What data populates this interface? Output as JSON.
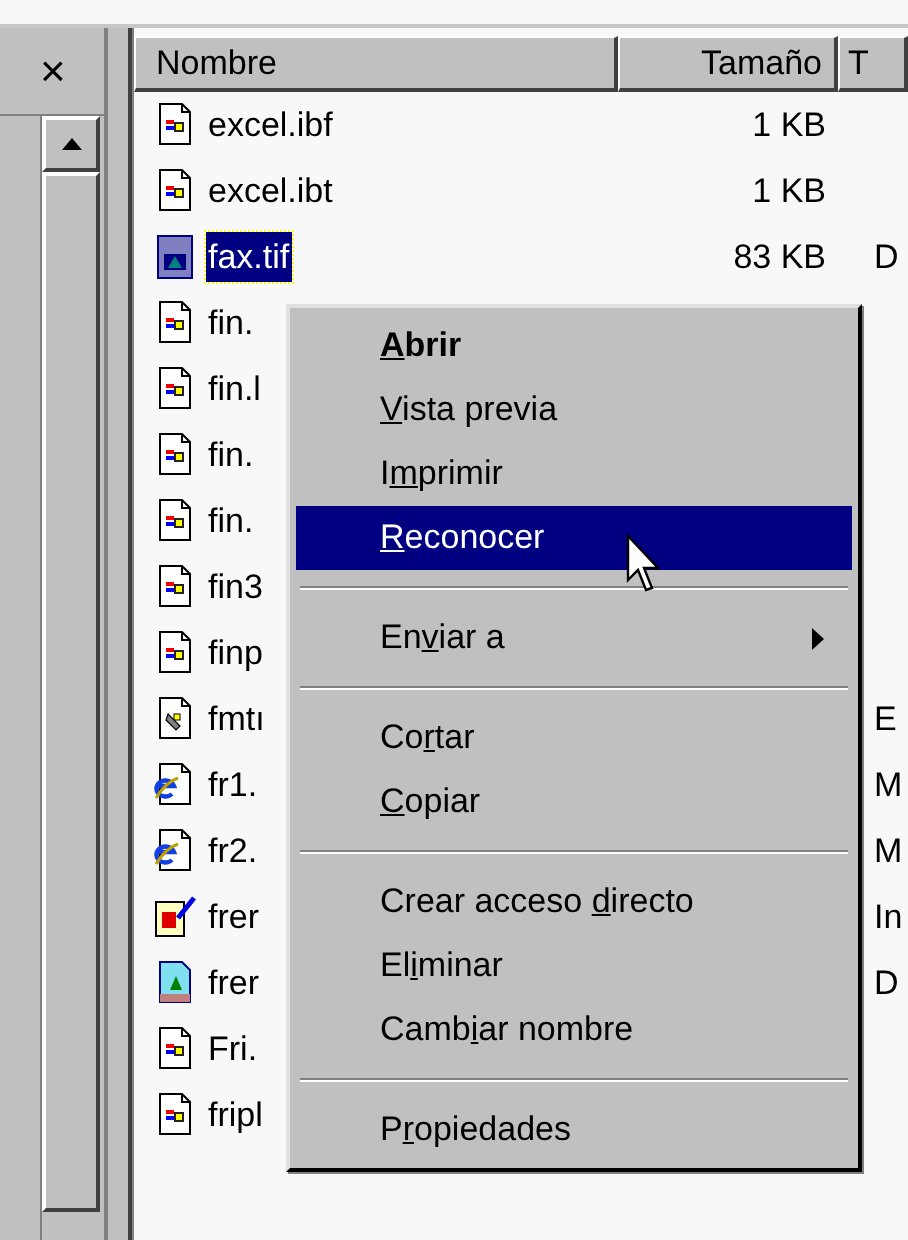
{
  "left_pane": {
    "close": "×"
  },
  "table": {
    "columns": [
      "Nombre",
      "Tamaño",
      "T"
    ],
    "rows": [
      {
        "kind": "doc",
        "name": "excel.ibf",
        "size": "1 KB",
        "selected": false
      },
      {
        "kind": "doc",
        "name": "excel.ibt",
        "size": "1 KB",
        "selected": false
      },
      {
        "kind": "image",
        "name": "fax.tif",
        "size": "83 KB",
        "type": "D",
        "selected": true
      },
      {
        "kind": "doc",
        "name": "fin.",
        "selected": false
      },
      {
        "kind": "doc",
        "name": "fin.l",
        "selected": false
      },
      {
        "kind": "doc",
        "name": "fin.",
        "selected": false
      },
      {
        "kind": "doc",
        "name": "fin.",
        "selected": false
      },
      {
        "kind": "doc",
        "name": "fin3",
        "selected": false
      },
      {
        "kind": "doc",
        "name": "finp",
        "selected": false
      },
      {
        "kind": "gear",
        "name": "fmtı",
        "type": "E",
        "selected": false
      },
      {
        "kind": "web",
        "name": "fr1.",
        "type": "M",
        "selected": false
      },
      {
        "kind": "web",
        "name": "fr2.",
        "type": "M",
        "selected": false
      },
      {
        "kind": "edit",
        "name": "frer",
        "type": "In",
        "selected": false
      },
      {
        "kind": "picture",
        "name": "frer",
        "type": "D",
        "selected": false
      },
      {
        "kind": "doc",
        "name": "Fri.",
        "selected": false
      },
      {
        "kind": "doc",
        "name": "fripl",
        "selected": false
      }
    ]
  },
  "context_menu": {
    "items": [
      {
        "kind": "item",
        "key": "A",
        "after": "brir",
        "default": true,
        "selected": false,
        "submenu": false
      },
      {
        "kind": "item",
        "key": "V",
        "after": "ista previa",
        "default": false,
        "selected": false,
        "submenu": false
      },
      {
        "kind": "item",
        "before": "I",
        "key": "m",
        "after": "primir",
        "default": false,
        "selected": false,
        "submenu": false
      },
      {
        "kind": "item",
        "key": "R",
        "after": "econocer",
        "default": false,
        "selected": true,
        "submenu": false
      },
      {
        "kind": "separator"
      },
      {
        "kind": "item",
        "before": "En",
        "key": "v",
        "after": "iar a",
        "default": false,
        "selected": false,
        "submenu": true
      },
      {
        "kind": "separator"
      },
      {
        "kind": "item",
        "before": "Co",
        "key": "r",
        "after": "tar",
        "default": false,
        "selected": false,
        "submenu": false
      },
      {
        "kind": "item",
        "key": "C",
        "after": "opiar",
        "default": false,
        "selected": false,
        "submenu": false
      },
      {
        "kind": "separator"
      },
      {
        "kind": "item",
        "before": "Crear acceso ",
        "key": "d",
        "after": "irecto",
        "default": false,
        "selected": false,
        "submenu": false
      },
      {
        "kind": "item",
        "before": "El",
        "key": "i",
        "after": "minar",
        "default": false,
        "selected": false,
        "submenu": false
      },
      {
        "kind": "item",
        "before": "Camb",
        "key": "i",
        "after": "ar nombre",
        "default": false,
        "selected": false,
        "submenu": false
      },
      {
        "kind": "separator"
      },
      {
        "kind": "item",
        "before": "P",
        "key": "r",
        "after": "opiedades",
        "default": false,
        "selected": false,
        "submenu": false
      }
    ]
  }
}
